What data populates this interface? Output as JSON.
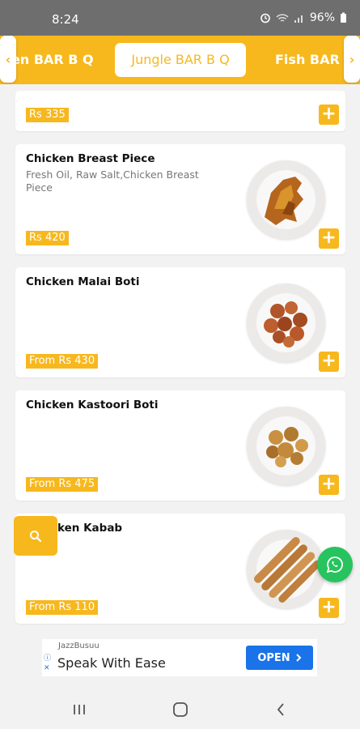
{
  "status_bar": {
    "time": "8:24",
    "battery": "96%"
  },
  "categories": {
    "left": "en BAR B Q",
    "active": "Jungle BAR B Q",
    "right": "Fish BAR B",
    "left_arrow": "‹",
    "right_arrow": "›"
  },
  "items": [
    {
      "name": "",
      "description": "",
      "price": "Rs 335"
    },
    {
      "name": "Chicken Breast Piece",
      "description": "Fresh Oil, Raw Salt,Chicken Breast Piece",
      "price": "Rs 420"
    },
    {
      "name": "Chicken Malai Boti",
      "description": "",
      "price": "From Rs 430"
    },
    {
      "name": "Chicken Kastoori Boti",
      "description": "",
      "price": "From Rs 475"
    },
    {
      "name": "ken Kabab",
      "description": "",
      "price": "From Rs 110"
    }
  ],
  "add_label": "+",
  "ad": {
    "advertiser": "JazzBusuu",
    "headline": "Speak With Ease",
    "cta": "OPEN"
  },
  "icons": {
    "search": "search-icon",
    "whatsapp": "whatsapp-icon"
  },
  "colors": {
    "accent": "#f7b81e",
    "whatsapp": "#27c35e",
    "ad_button": "#1a73e8"
  }
}
